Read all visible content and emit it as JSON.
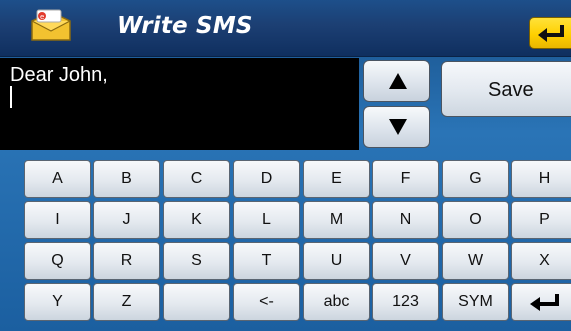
{
  "header": {
    "title": "Write SMS",
    "app_icon": "sms-envelope-icon",
    "back_icon": "return-arrow-icon"
  },
  "message": {
    "text": "Dear John,"
  },
  "controls": {
    "scroll_up_icon": "triangle-up-icon",
    "scroll_down_icon": "triangle-down-icon",
    "save_label": "Save"
  },
  "keyboard": {
    "rows": [
      [
        "A",
        "B",
        "C",
        "D",
        "E",
        "F",
        "G",
        "H"
      ],
      [
        "I",
        "J",
        "K",
        "L",
        "M",
        "N",
        "O",
        "P"
      ],
      [
        "Q",
        "R",
        "S",
        "T",
        "U",
        "V",
        "W",
        "X"
      ],
      [
        "Y",
        "Z",
        "",
        "<-",
        "abc",
        "123",
        "SYM",
        ""
      ]
    ],
    "enter_icon": "enter-arrow-icon"
  },
  "colors": {
    "header_dark": "#0f2f5f",
    "background_blue": "#2a74b6",
    "accent_yellow": "#ffd000",
    "text_area_bg": "#000000"
  }
}
